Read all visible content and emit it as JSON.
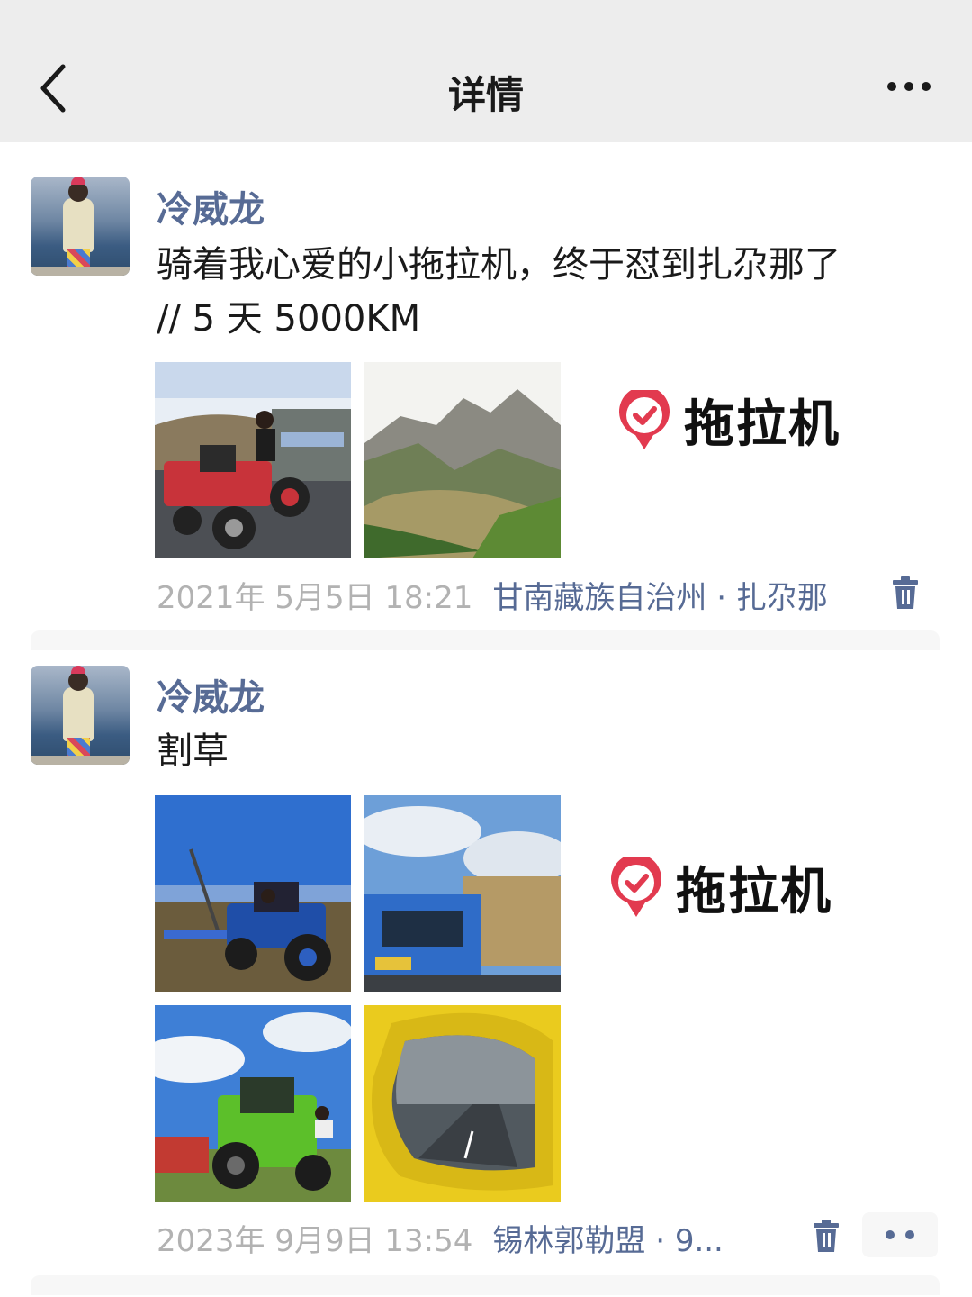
{
  "header": {
    "title": "详情",
    "back_icon": "chevron-left-icon",
    "more_icon": "more-horizontal-icon"
  },
  "posts": [
    {
      "author": "冷威龙",
      "text_line1": "骑着我心爱的小拖拉机，终于怼到扎尕那了",
      "text_line2": "// 5 天 5000KM",
      "time": "2021年 5月5日 18:21",
      "location": "甘南藏族自治州 · 扎尕那",
      "sticker": "拖拉机"
    },
    {
      "author": "冷威龙",
      "text_line1": "割草",
      "time": "2023年 9月9日 13:54",
      "location": "锡林郭勒盟 · 9...",
      "sticker": "拖拉机"
    }
  ],
  "colors": {
    "link": "#576b95",
    "header_bg": "#ededed",
    "time": "#b2b2b2"
  }
}
